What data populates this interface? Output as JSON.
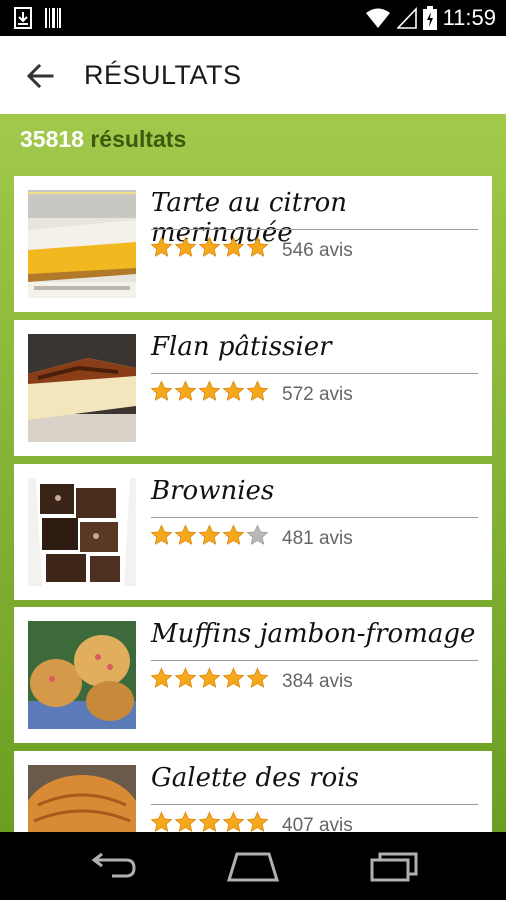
{
  "status_bar": {
    "time": "11:59",
    "icons": [
      "download-icon",
      "barcode-icon",
      "wifi-icon",
      "signal-icon",
      "battery-charging-icon"
    ]
  },
  "action_bar": {
    "back_icon": "arrow-left-icon",
    "title": "RÉSULTATS"
  },
  "results": {
    "count": "35818",
    "label": "résultats"
  },
  "recipes": [
    {
      "title": "Tarte au citron meringuée",
      "rating": 5,
      "reviews": "546 avis"
    },
    {
      "title": "Flan pâtissier",
      "rating": 5,
      "reviews": "572 avis"
    },
    {
      "title": "Brownies",
      "rating": 4,
      "reviews": "481 avis"
    },
    {
      "title": "Muffins jambon-fromage",
      "rating": 5,
      "reviews": "384 avis"
    },
    {
      "title": "Galette des rois",
      "rating": 5,
      "reviews": "407 avis"
    }
  ],
  "rating_max": 5,
  "colors": {
    "star_filled": "#f5a81c",
    "star_empty": "#b8b8b8",
    "accent_green": "#8bbb3a"
  },
  "nav_bar": {
    "icons": [
      "back-nav-icon",
      "home-nav-icon",
      "recents-nav-icon"
    ]
  }
}
